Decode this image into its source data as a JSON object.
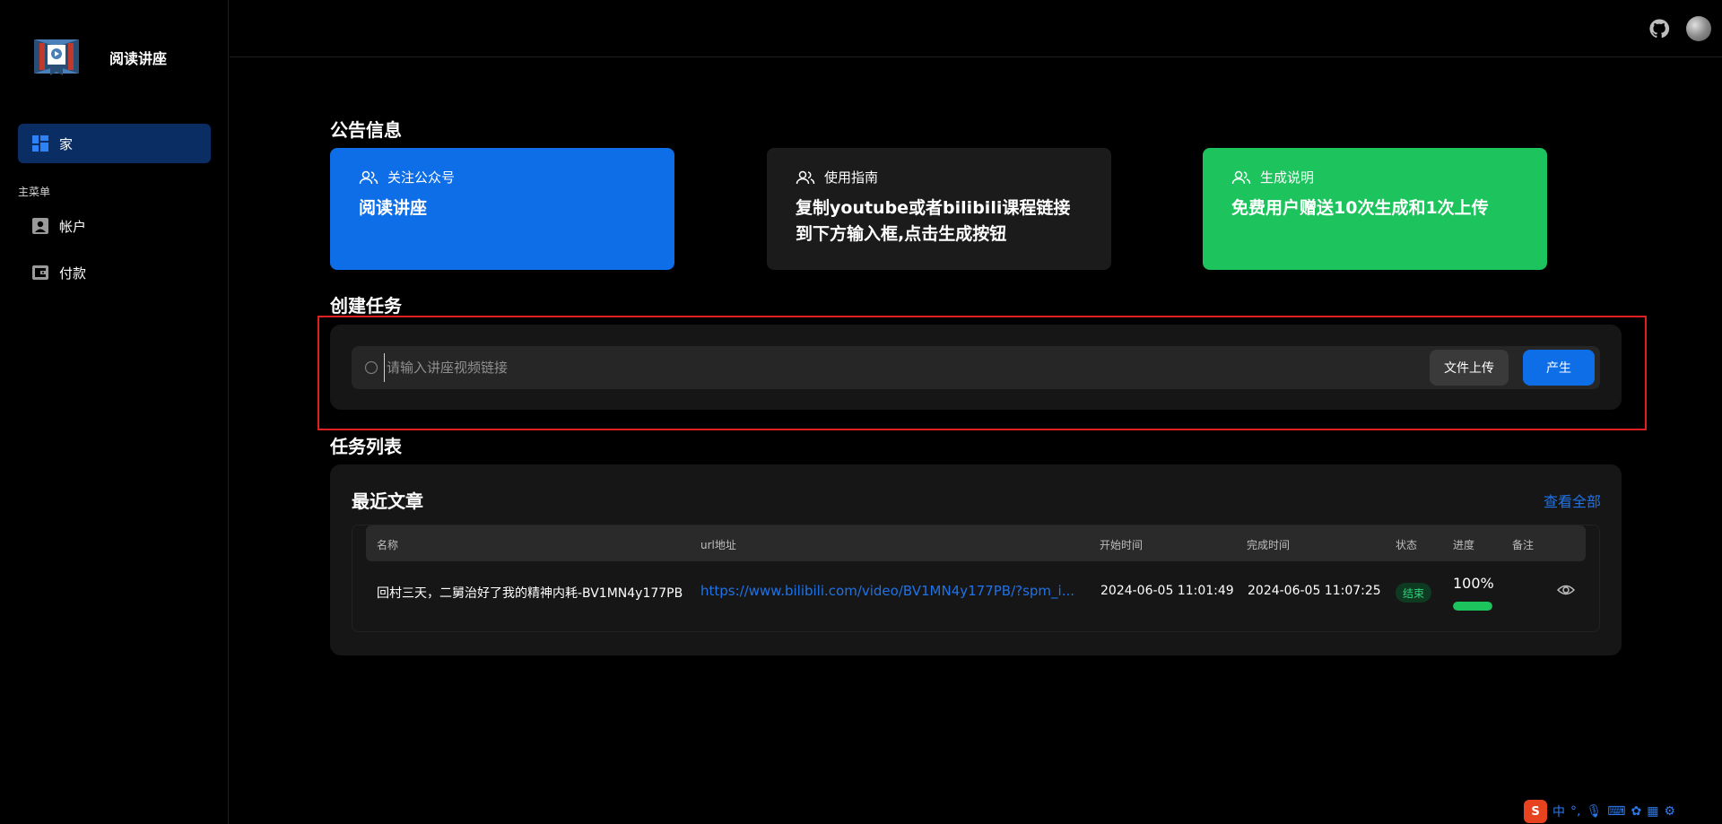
{
  "app": {
    "name": "阅读讲座"
  },
  "sidebar": {
    "home_label": "家",
    "section_label": "主菜单",
    "items": [
      {
        "label": "帐户",
        "icon": "user-icon"
      },
      {
        "label": "付款",
        "icon": "wallet-icon"
      }
    ]
  },
  "topbar": {
    "icons": [
      "github-icon",
      "avatar"
    ]
  },
  "announcement": {
    "title": "公告信息",
    "cards": [
      {
        "head": "关注公众号",
        "body": "阅读讲座",
        "color": "#0d6ee8",
        "icon": "users-icon"
      },
      {
        "head": "使用指南",
        "body": "复制youtube或者bilibili课程链接到下方输入框,点击生成按钮",
        "color": "#1b1b1b",
        "icon": "users-icon"
      },
      {
        "head": "生成说明",
        "body": "免费用户赠送10次生成和1次上传",
        "color": "#1dc45d",
        "icon": "users-icon"
      }
    ]
  },
  "create_task": {
    "title": "创建任务",
    "input_placeholder": "请输入讲座视频链接",
    "upload_label": "文件上传",
    "generate_label": "产生"
  },
  "task_list": {
    "title": "任务列表",
    "panel_title": "最近文章",
    "view_all": "查看全部",
    "columns": [
      "名称",
      "url地址",
      "开始时间",
      "完成时间",
      "状态",
      "进度",
      "备注"
    ],
    "rows": [
      {
        "name": "回村三天，二舅治好了我的精神内耗-BV1MN4y177PB",
        "url": "https://www.bilibili.com/video/BV1MN4y177PB/?spm_i...",
        "start": "2024-06-05 11:01:49",
        "end": "2024-06-05 11:07:25",
        "status": "结束",
        "progress_text": "100%",
        "progress": 1.0
      }
    ]
  },
  "tray": {
    "ime": "中",
    "punct": "°,"
  }
}
